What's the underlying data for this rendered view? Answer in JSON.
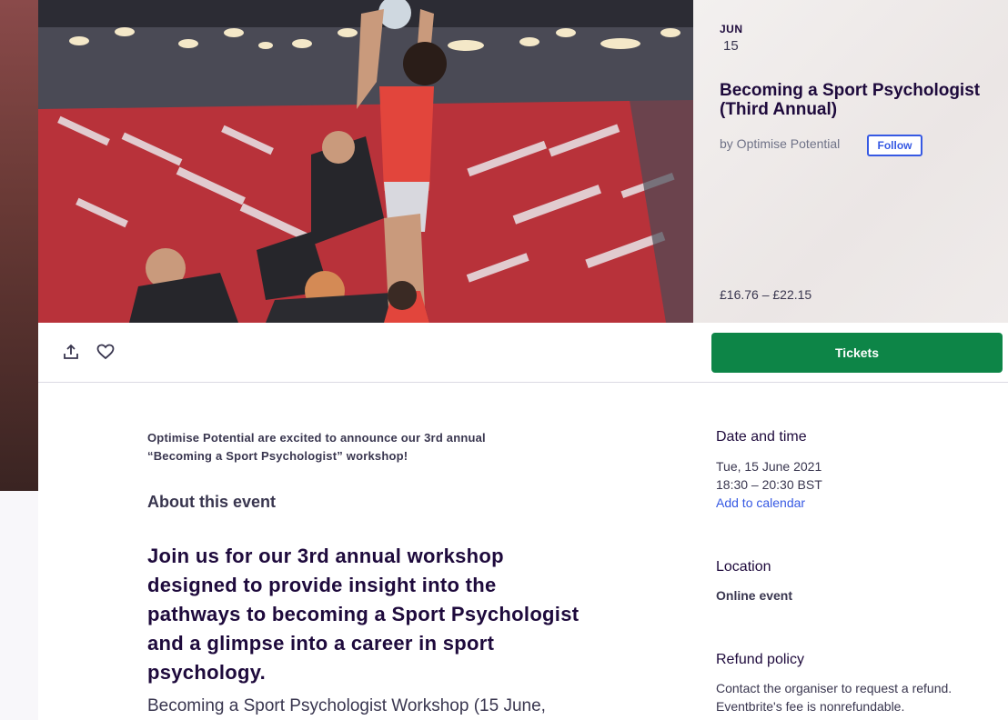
{
  "event": {
    "month": "JUN",
    "day": "15",
    "title": "Becoming a Sport Psychologist (Third Annual)",
    "organiser": "by Optimise Potential",
    "follow_label": "Follow",
    "price": "£16.76 – £22.15"
  },
  "actions": {
    "share_icon": "share-icon",
    "like_icon": "heart-icon",
    "tickets_label": "Tickets"
  },
  "description": {
    "intro_line1": "Optimise Potential are excited to announce our 3rd annual",
    "intro_line2": "“Becoming a Sport Psychologist” workshop!",
    "about_heading": "About this event",
    "lead_lines": [
      "Join us for our 3rd annual workshop",
      "designed to provide insight into the",
      "pathways to becoming a Sport Psychologist",
      "and a glimpse into a career in sport",
      "psychology."
    ],
    "body_partial": "Becoming a Sport Psychologist Workshop (15 June,"
  },
  "sidebar": {
    "date_heading": "Date and time",
    "date": "Tue, 15 June 2021",
    "time": "18:30 – 20:30 BST",
    "add_to_calendar": "Add to calendar",
    "location_heading": "Location",
    "location": "Online event",
    "refund_heading": "Refund policy",
    "refund_line1": "Contact the organiser to request a refund.",
    "refund_line2": "Eventbrite's fee is nonrefundable."
  },
  "colors": {
    "tickets_green": "#0d8547",
    "link_blue": "#3659e3",
    "title_ink": "#1e0a3c"
  }
}
